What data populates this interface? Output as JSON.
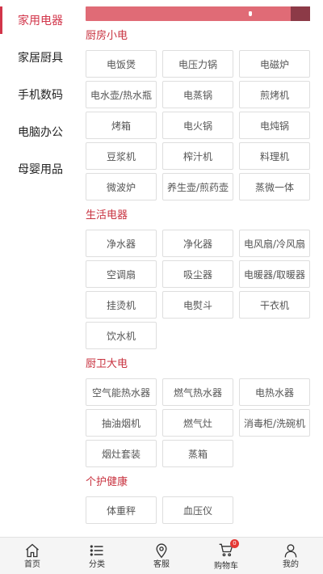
{
  "sidebar": {
    "items": [
      {
        "label": "家用电器",
        "active": true
      },
      {
        "label": "家居厨具",
        "active": false
      },
      {
        "label": "手机数码",
        "active": false
      },
      {
        "label": "电脑办公",
        "active": false
      },
      {
        "label": "母婴用品",
        "active": false
      }
    ]
  },
  "sections": [
    {
      "title": "厨房小电",
      "items": [
        "电饭煲",
        "电压力锅",
        "电磁炉",
        "电水壶/热水瓶",
        "电蒸锅",
        "煎烤机",
        "烤箱",
        "电火锅",
        "电炖锅",
        "豆浆机",
        "榨汁机",
        "料理机",
        "微波炉",
        "养生壶/煎药壶",
        "蒸微一体"
      ]
    },
    {
      "title": "生活电器",
      "items": [
        "净水器",
        "净化器",
        "电风扇/冷风扇",
        "空调扇",
        "吸尘器",
        "电暖器/取暖器",
        "挂烫机",
        "电熨斗",
        "干衣机",
        "饮水机"
      ]
    },
    {
      "title": "厨卫大电",
      "items": [
        "空气能热水器",
        "燃气热水器",
        "电热水器",
        "抽油烟机",
        "燃气灶",
        "消毒柜/洗碗机",
        "烟灶套装",
        "蒸箱"
      ]
    },
    {
      "title": "个护健康",
      "items": [
        "体重秤",
        "血压仪"
      ]
    }
  ],
  "tabbar": {
    "items": [
      {
        "label": "首页",
        "icon": "home-icon"
      },
      {
        "label": "分类",
        "icon": "list-icon"
      },
      {
        "label": "客服",
        "icon": "location-pin-icon"
      },
      {
        "label": "购物车",
        "icon": "cart-icon",
        "badge": "0"
      },
      {
        "label": "我的",
        "icon": "user-icon"
      }
    ]
  },
  "colors": {
    "accent": "#d2354a",
    "banner": "#e06b76",
    "banner_dark": "#8c3a47"
  }
}
